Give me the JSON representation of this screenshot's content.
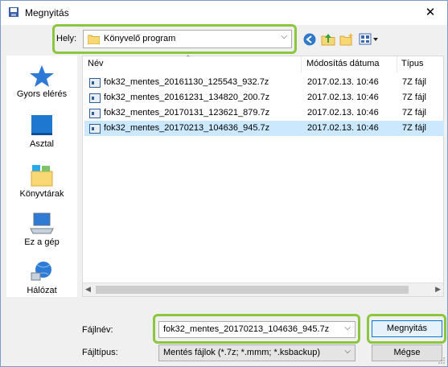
{
  "window": {
    "title": "Megnyitás",
    "close_glyph": "✕"
  },
  "location": {
    "label": "Hely:",
    "value": "Könyvelő program",
    "dropdown_glyph": "⌵"
  },
  "toolbar_icons": [
    "back-icon",
    "up-folder-icon",
    "new-folder-icon",
    "view-menu-icon"
  ],
  "places": [
    {
      "label": "Gyors elérés",
      "icon": "quick-access-star-icon"
    },
    {
      "label": "Asztal",
      "icon": "desktop-icon"
    },
    {
      "label": "Könyvtárak",
      "icon": "libraries-icon"
    },
    {
      "label": "Ez a gép",
      "icon": "computer-icon"
    },
    {
      "label": "Hálózat",
      "icon": "network-icon"
    }
  ],
  "columns": {
    "name": "Név",
    "date": "Módosítás dátuma",
    "type": "Típus"
  },
  "files": [
    {
      "name": "fok32_mentes_20161130_125543_932.7z",
      "date": "2017.02.13. 10:46",
      "type": "7Z fájl",
      "selected": false
    },
    {
      "name": "fok32_mentes_20161231_134820_200.7z",
      "date": "2017.02.13. 10:46",
      "type": "7Z fájl",
      "selected": false
    },
    {
      "name": "fok32_mentes_20170131_123621_879.7z",
      "date": "2017.02.13. 10:46",
      "type": "7Z fájl",
      "selected": false
    },
    {
      "name": "fok32_mentes_20170213_104636_945.7z",
      "date": "2017.02.13. 10:46",
      "type": "7Z fájl",
      "selected": true
    }
  ],
  "filename": {
    "label": "Fájlnév:",
    "value": "fok32_mentes_20170213_104636_945.7z"
  },
  "filetype": {
    "label": "Fájltípus:",
    "value": "Mentés fájlok (*.7z; *.mmm; *.ksbackup)"
  },
  "buttons": {
    "open": "Megnyitás",
    "cancel": "Mégse"
  },
  "colors": {
    "highlight": "#8cc63f",
    "selection": "#cce8ff",
    "accent": "#0078d7"
  }
}
